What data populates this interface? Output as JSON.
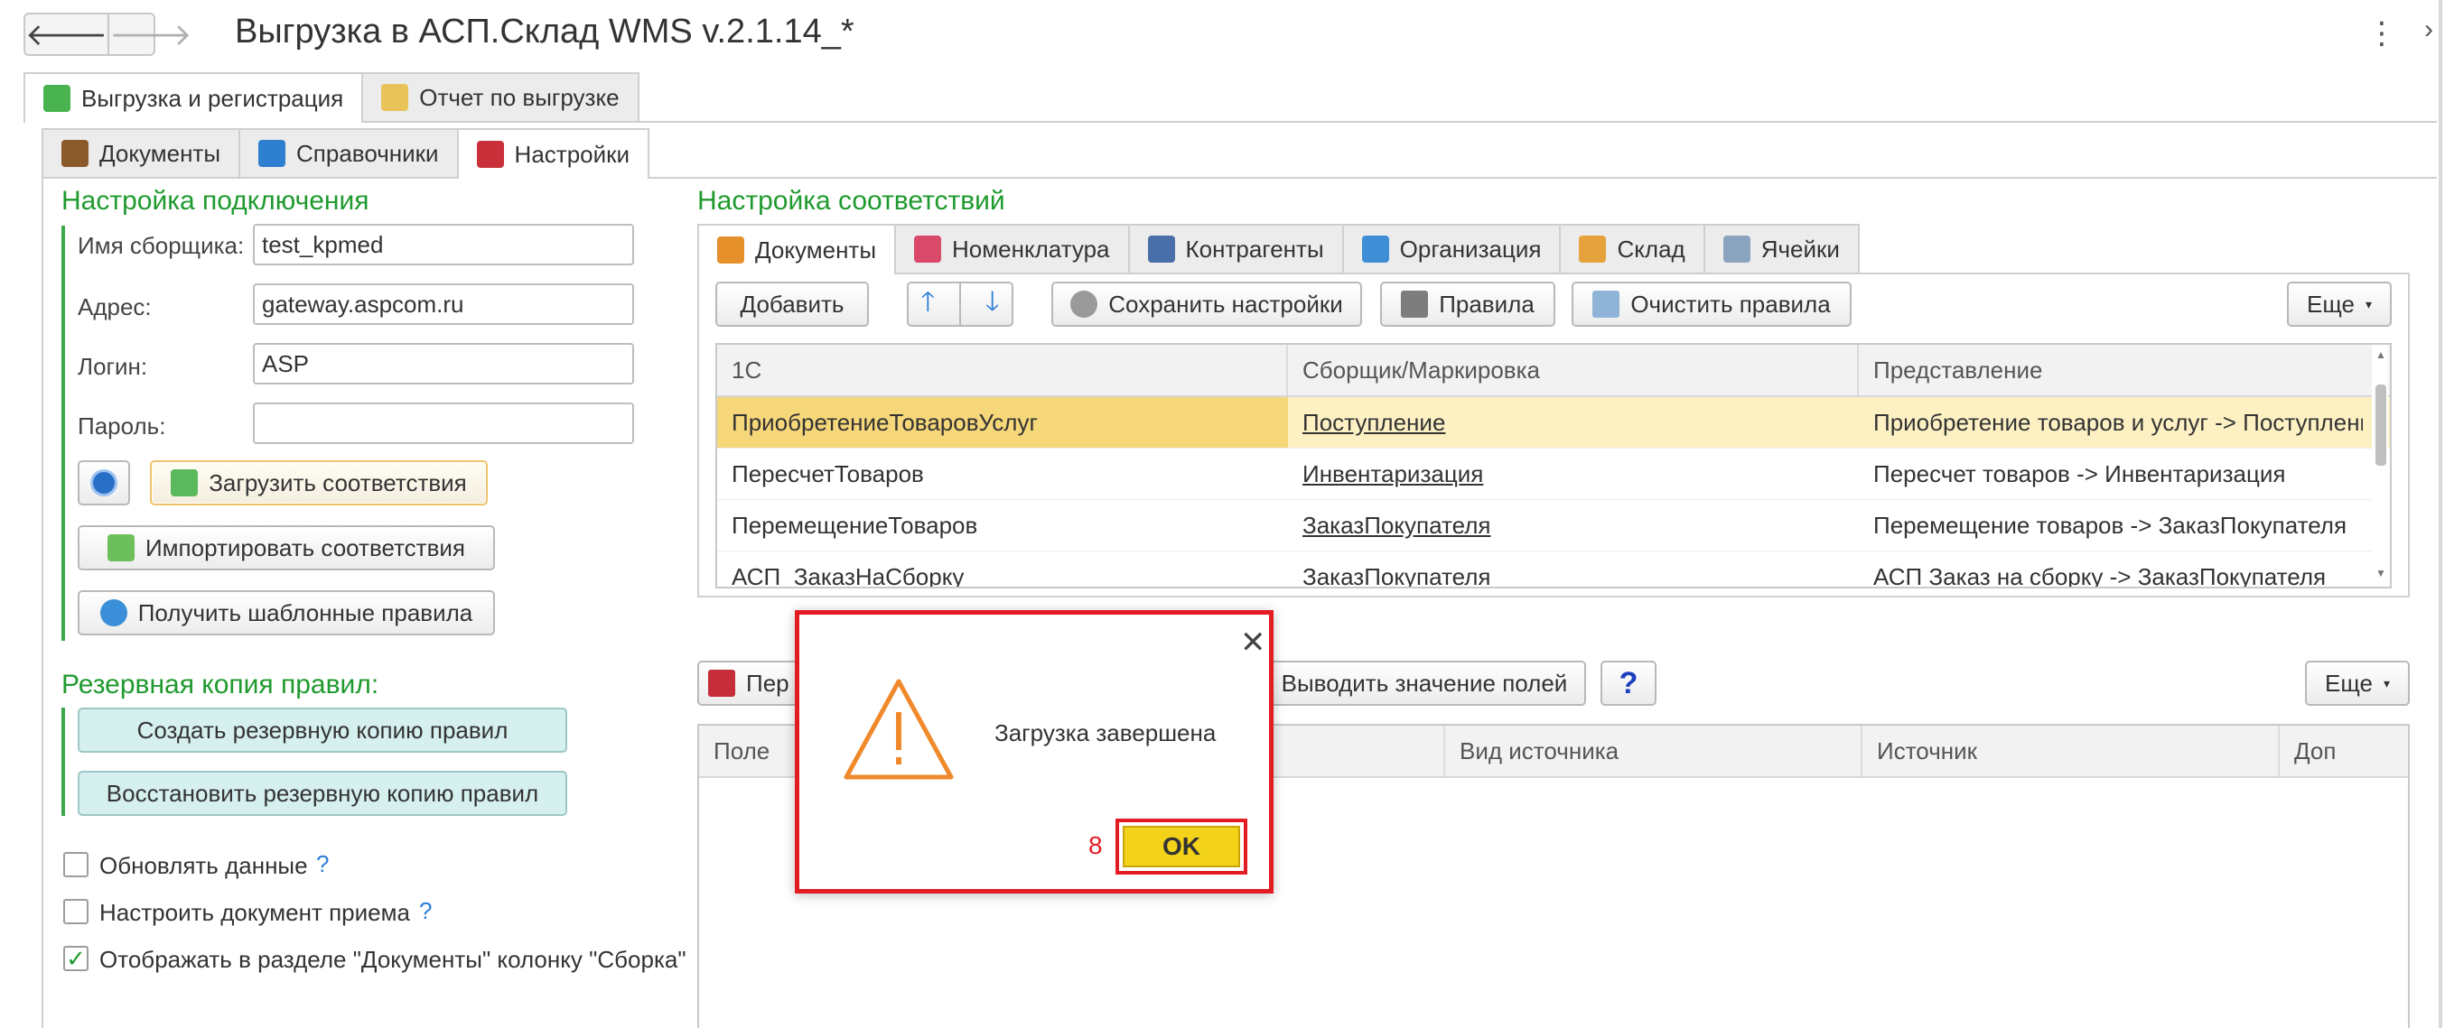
{
  "window": {
    "title": "Выгрузка в АСП.Склад WMS v.2.1.14_*",
    "back_glyph": "🡐",
    "forward_glyph": "🡒",
    "more_glyph": "⋮",
    "side_arrow_glyph": "›"
  },
  "main_tabs": [
    {
      "label": "Выгрузка и регистрация",
      "icon": "export-icon",
      "active": true
    },
    {
      "label": "Отчет по выгрузке",
      "icon": "report-icon",
      "active": false
    }
  ],
  "sub_tabs": [
    {
      "label": "Документы",
      "icon": "briefcase-icon",
      "active": false
    },
    {
      "label": "Справочники",
      "icon": "book-icon",
      "active": false
    },
    {
      "label": "Настройки",
      "icon": "settings-icon",
      "active": true
    }
  ],
  "connection": {
    "title": "Настройка подключения",
    "fields": [
      {
        "label": "Имя сборщика:",
        "value": "test_kpmed"
      },
      {
        "label": "Адрес:",
        "value": "gateway.aspcom.ru"
      },
      {
        "label": "Логин:",
        "value": "ASP"
      },
      {
        "label": "Пароль:",
        "value": ""
      }
    ],
    "load_button": "Загрузить соответствия",
    "import_button": "Импортировать соответствия",
    "templates_button": "Получить шаблонные правила"
  },
  "backup": {
    "title": "Резервная копия правил:",
    "create_button": "Создать резервную копию правил",
    "restore_button": "Восстановить резервную копию правил"
  },
  "options": [
    {
      "label": "Обновлять данные",
      "checked": false,
      "help": "?"
    },
    {
      "label": "Настроить документ приема",
      "checked": false,
      "help": "?"
    },
    {
      "label": "Отображать в разделе \"Документы\" колонку \"Сборка\"",
      "checked": true,
      "help": ""
    }
  ],
  "mapping": {
    "title": "Настройка соответствий",
    "tabs": [
      {
        "label": "Документы",
        "icon": "documents-icon",
        "active": true
      },
      {
        "label": "Номенклатура",
        "icon": "nomenclature-icon",
        "active": false
      },
      {
        "label": "Контрагенты",
        "icon": "counterparties-icon",
        "active": false
      },
      {
        "label": "Организация",
        "icon": "organization-icon",
        "active": false
      },
      {
        "label": "Склад",
        "icon": "warehouse-icon",
        "active": false
      },
      {
        "label": "Ячейки",
        "icon": "cells-icon",
        "active": false
      }
    ],
    "toolbar": {
      "add": "Добавить",
      "save": "Сохранить настройки",
      "rules": "Правила",
      "clear": "Очистить правила",
      "more": "Еще"
    },
    "columns": [
      "1С",
      "Сборщик/Маркировка",
      "Представление"
    ],
    "rows": [
      {
        "c1": "ПриобретениеТоваровУслуг",
        "c2": "Поступление",
        "c3": "Приобретение товаров и услуг -> Поступление",
        "selected": true
      },
      {
        "c1": "ПересчетТоваров",
        "c2": "Инвентаризация",
        "c3": "Пересчет товаров -> Инвентаризация",
        "selected": false
      },
      {
        "c1": "ПеремещениеТоваров",
        "c2": "ЗаказПокупателя",
        "c3": "Перемещение товаров -> ЗаказПокупателя",
        "selected": false
      },
      {
        "c1": "АСП_ЗаказНаСборку",
        "c2": "ЗаказПокупателя",
        "c3": "АСП Заказ на сборку -> ЗаказПокупателя",
        "selected": false
      }
    ]
  },
  "fields_panel": {
    "first_button_partial": "Пер",
    "show_values_button": "Выводить значение полей",
    "help_button": "?",
    "more": "Еще",
    "columns": [
      "Поле",
      "Вид источника",
      "Источник",
      "Доп"
    ]
  },
  "dialog": {
    "message": "Загрузка завершена",
    "ok_label": "OK",
    "step_number": "8",
    "close_glyph": "✕"
  },
  "colors": {
    "section_green": "#1f9a2e",
    "selection_yellow": "#fdf1c4",
    "ok_yellow": "#f3d21a",
    "highlight_red": "#e31b23"
  }
}
